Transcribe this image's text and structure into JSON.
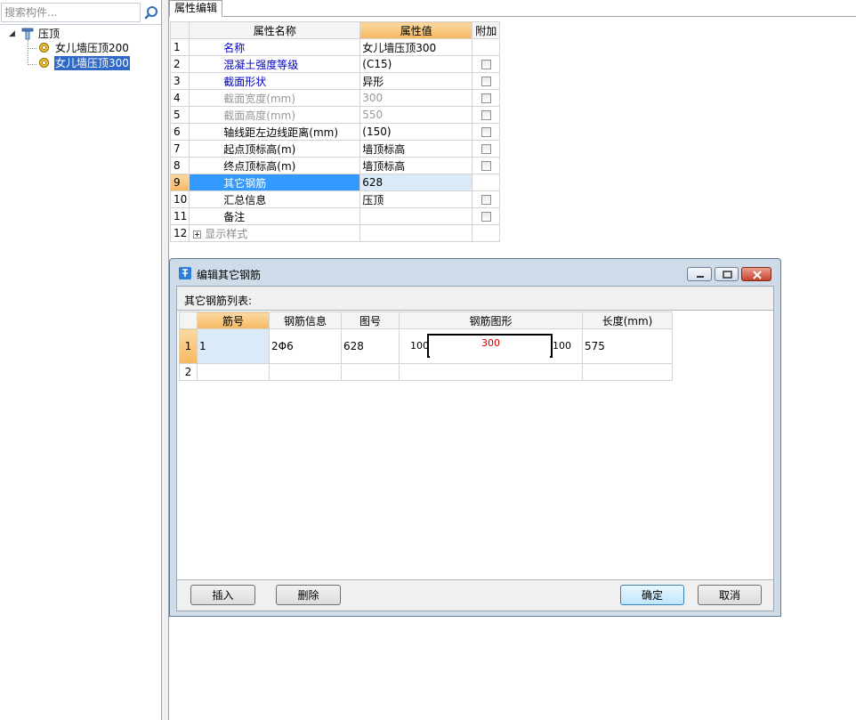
{
  "search": {
    "placeholder": "搜索构件..."
  },
  "tree": {
    "root": {
      "label": "压顶"
    },
    "children": [
      {
        "label": "女儿墙压顶200",
        "selected": false
      },
      {
        "label": "女儿墙压顶300",
        "selected": true
      }
    ]
  },
  "tab": {
    "label": "属性编辑"
  },
  "prop_grid": {
    "headers": {
      "name": "属性名称",
      "value": "属性值",
      "extra": "附加"
    },
    "rows": [
      {
        "num": "1",
        "name": "名称",
        "value": "女儿墙压顶300"
      },
      {
        "num": "2",
        "name": "混凝土强度等级",
        "value": "(C15)"
      },
      {
        "num": "3",
        "name": "截面形状",
        "value": "异形"
      },
      {
        "num": "4",
        "name": "截面宽度(mm)",
        "value": "300"
      },
      {
        "num": "5",
        "name": "截面高度(mm)",
        "value": "550"
      },
      {
        "num": "6",
        "name": "轴线距左边线距离(mm)",
        "value": "(150)"
      },
      {
        "num": "7",
        "name": "起点顶标高(m)",
        "value": "墙顶标高"
      },
      {
        "num": "8",
        "name": "终点顶标高(m)",
        "value": "墙顶标高"
      },
      {
        "num": "9",
        "name": "其它钢筋",
        "value": "628"
      },
      {
        "num": "10",
        "name": "汇总信息",
        "value": "压顶"
      },
      {
        "num": "11",
        "name": "备注",
        "value": ""
      },
      {
        "num": "12",
        "name": "显示样式",
        "value": ""
      }
    ]
  },
  "dialog": {
    "title": "编辑其它钢筋",
    "list_label": "其它钢筋列表:",
    "headers": {
      "bar_no": "筋号",
      "bar_info": "钢筋信息",
      "fig_no": "图号",
      "shape": "钢筋图形",
      "length": "长度(mm)"
    },
    "rows": [
      {
        "num": "1",
        "bar_no": "1",
        "bar_info": "2Φ6",
        "fig_no": "628",
        "dim_left": "100",
        "dim_top": "300",
        "dim_right": "100",
        "length": "575"
      },
      {
        "num": "2",
        "bar_no": "",
        "bar_info": "",
        "fig_no": "",
        "length": ""
      }
    ],
    "buttons": {
      "insert": "插入",
      "delete": "删除",
      "ok": "确定",
      "cancel": "取消"
    }
  },
  "colors": {
    "selection": "#3399ff",
    "header_active": "#f5b960",
    "tree_selected": "#3169c6",
    "dim_highlight": "#d00000"
  }
}
